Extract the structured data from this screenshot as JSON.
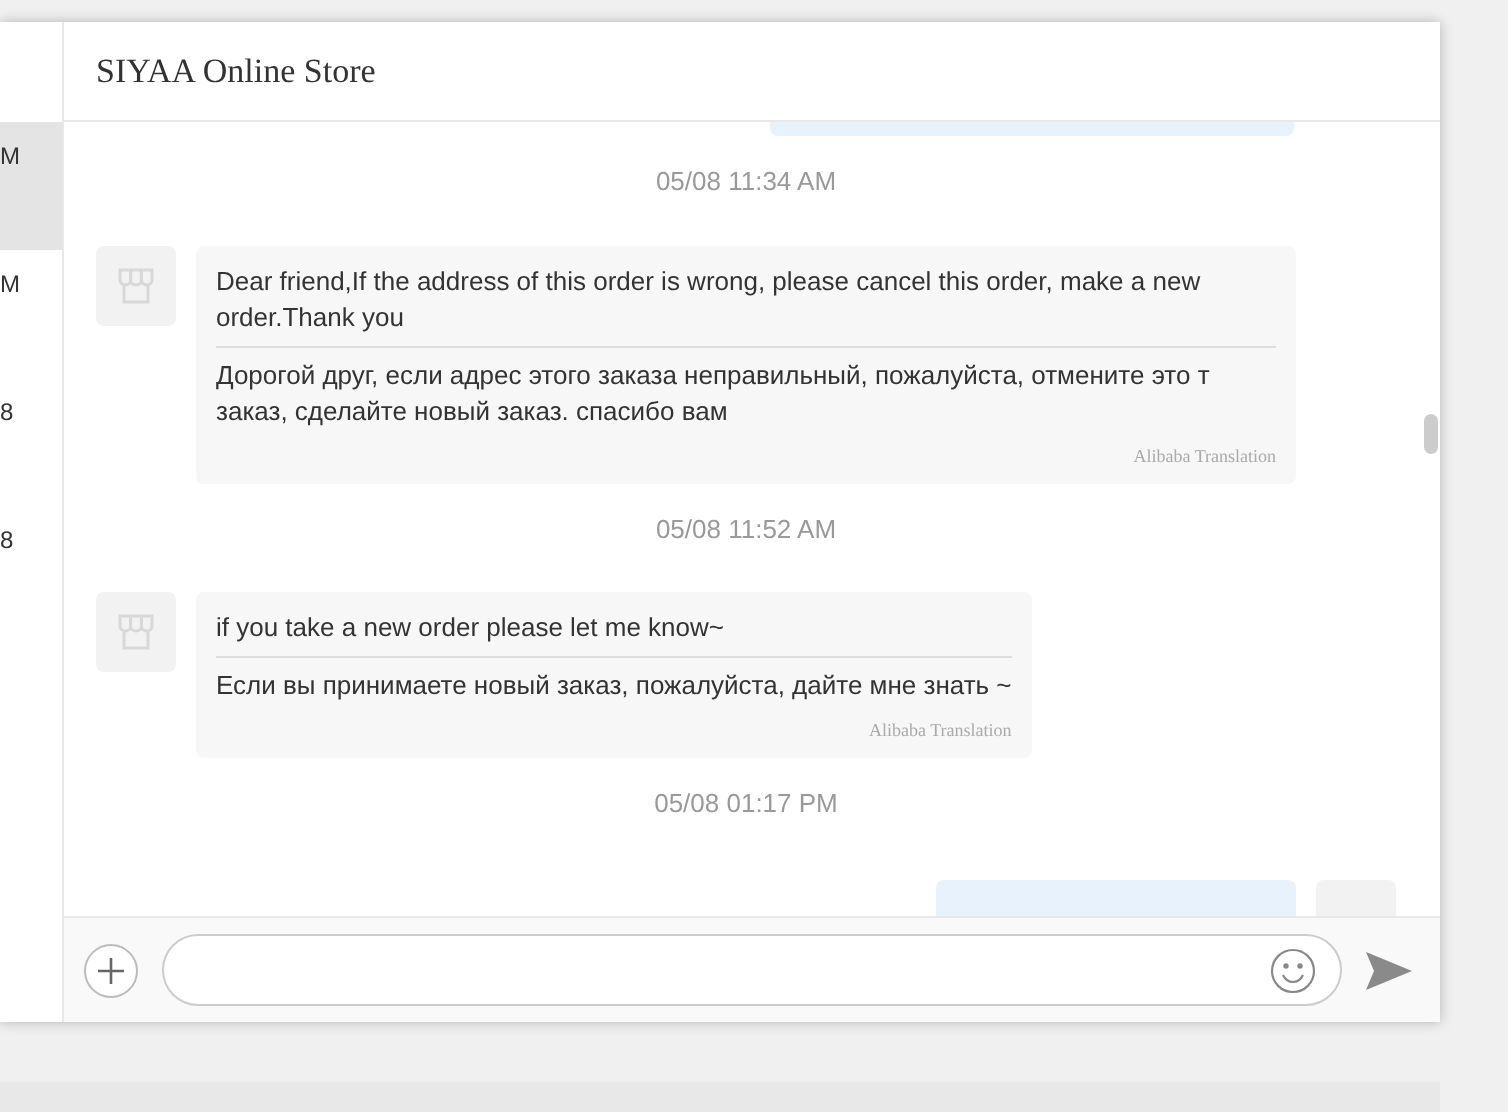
{
  "sidebar": {
    "items": [
      {
        "text": "M",
        "selected": true
      },
      {
        "text": "M",
        "selected": false
      },
      {
        "text": "8",
        "selected": false
      },
      {
        "text": "8",
        "selected": false
      }
    ]
  },
  "chat": {
    "title": "SIYAA Online Store",
    "messages": [
      {
        "kind": "outgoing"
      },
      {
        "kind": "time",
        "text": "05/08 11:34 AM"
      },
      {
        "kind": "incoming",
        "text": "Dear friend,If the address of this order is wrong, please cancel this order, make a new order.Thank you",
        "translation": "Дорогой друг, если адрес этого заказа неправильный, пожалуйста, отмените это т заказ, сделайте новый заказ. спасибо вам",
        "credit": "Alibaba Translation"
      },
      {
        "kind": "time",
        "text": "05/08 11:52 AM"
      },
      {
        "kind": "incoming",
        "text": "if you take a new order please let me know~",
        "translation": "Если вы принимаете новый заказ, пожалуйста, дайте мне знать ~",
        "credit": "Alibaba Translation"
      },
      {
        "kind": "time",
        "text": "05/08 01:17 PM"
      },
      {
        "kind": "outgoing"
      }
    ]
  }
}
